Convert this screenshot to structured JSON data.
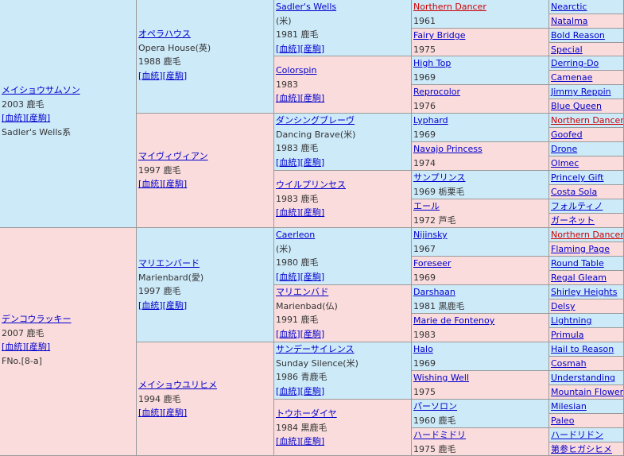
{
  "sire": {
    "name": "メイショウサムソン",
    "year_color": "2003 鹿毛",
    "links": [
      "[血統]",
      "[産駒]"
    ],
    "line": "Sadler's Wells系",
    "sire": {
      "name": "オペラハウス",
      "name_en": "Opera House(英)",
      "year_color": "1988 鹿毛",
      "links": [
        "[血統]",
        "[産駒]"
      ],
      "sire": {
        "name": "Sadler's Wells",
        "country": "(米)",
        "year_color": "1981 鹿毛",
        "links": [
          "[血統]",
          "[産駒]"
        ],
        "sire": {
          "name": "Northern Dancer",
          "year": "1961",
          "sire": "Nearctic",
          "dam": "Natalma"
        },
        "dam": {
          "name": "Fairy Bridge",
          "year": "1975",
          "sire": "Bold Reason",
          "dam": "Special"
        }
      },
      "dam": {
        "name": "Colorspin",
        "year_color": "1983",
        "links": [
          "[血統]",
          "[産駒]"
        ],
        "sire": {
          "name": "High Top",
          "year": "1969",
          "sire": "Derring-Do",
          "dam": "Camenae"
        },
        "dam": {
          "name": "Reprocolor",
          "year": "1976",
          "sire": "Jimmy Reppin",
          "dam": "Blue Queen"
        }
      }
    },
    "dam": {
      "name": "マイヴィヴィアン",
      "year_color": "1997 鹿毛",
      "links": [
        "[血統]",
        "[産駒]"
      ],
      "sire": {
        "name": "ダンシングブレーヴ",
        "name_en": "Dancing Brave(米)",
        "year_color": "1983 鹿毛",
        "links": [
          "[血統]",
          "[産駒]"
        ],
        "sire": {
          "name": "Lyphard",
          "year": "1969",
          "sire": "Northern Dancer",
          "dam": "Goofed"
        },
        "dam": {
          "name": "Navajo Princess",
          "year": "1974",
          "sire": "Drone",
          "dam": "Olmec"
        }
      },
      "dam": {
        "name": "ウイルプリンセス",
        "year_color": "1983 鹿毛",
        "links": [
          "[血統]",
          "[産駒]"
        ],
        "sire": {
          "name": "サンプリンス",
          "year": "1969 栃栗毛",
          "sire": "Princely Gift",
          "dam": "Costa Sola"
        },
        "dam": {
          "name": "エール",
          "year": "1972 芦毛",
          "sire": "フォルティノ",
          "dam": "ガーネット"
        }
      }
    }
  },
  "dam": {
    "name": "デンコウラッキー",
    "year_color": "2007 鹿毛",
    "links": [
      "[血統]",
      "[産駒]"
    ],
    "family": "FNo.[8-a]",
    "sire": {
      "name": "マリエンバード",
      "name_en": "Marienbard(愛)",
      "year_color": "1997 鹿毛",
      "links": [
        "[血統]",
        "[産駒]"
      ],
      "sire": {
        "name": "Caerleon",
        "country": "(米)",
        "year_color": "1980 鹿毛",
        "links": [
          "[血統]",
          "[産駒]"
        ],
        "sire": {
          "name": "Nijinsky",
          "year": "1967",
          "sire": "Northern Dancer",
          "dam": "Flaming Page"
        },
        "dam": {
          "name": "Foreseer",
          "year": "1969",
          "sire": "Round Table",
          "dam": "Regal Gleam"
        }
      },
      "dam": {
        "name": "マリエンバド",
        "name_en": "Marienbad(仏)",
        "year_color": "1991 鹿毛",
        "links": [
          "[血統]",
          "[産駒]"
        ],
        "sire": {
          "name": "Darshaan",
          "year": "1981 黒鹿毛",
          "sire": "Shirley Heights",
          "dam": "Delsy"
        },
        "dam": {
          "name": "Marie de Fontenoy",
          "year": "1983",
          "sire": "Lightning",
          "dam": "Primula"
        }
      }
    },
    "dam": {
      "name": "メイショウユリヒメ",
      "year_color": "1994 鹿毛",
      "links": [
        "[血統]",
        "[産駒]"
      ],
      "sire": {
        "name": "サンデーサイレンス",
        "name_en": "Sunday Silence(米)",
        "year_color": "1986 青鹿毛",
        "links": [
          "[血統]",
          "[産駒]"
        ],
        "sire": {
          "name": "Halo",
          "year": "1969",
          "sire": "Hail to Reason",
          "dam": "Cosmah"
        },
        "dam": {
          "name": "Wishing Well",
          "year": "1975",
          "sire": "Understanding",
          "dam": "Mountain Flower"
        }
      },
      "dam": {
        "name": "トウホーダイヤ",
        "year_color": "1984 黒鹿毛",
        "links": [
          "[血統]",
          "[産駒]"
        ],
        "sire": {
          "name": "パーソロン",
          "year": "1960 鹿毛",
          "sire": "Milesian",
          "dam": "Paleo"
        },
        "dam": {
          "name": "ハードミドリ",
          "year": "1975 鹿毛",
          "sire": "ハードリドン",
          "dam": "第参ヒガシヒメ"
        }
      }
    }
  },
  "highlight_color": "#cc0000",
  "highlighted_names": [
    "Northern Dancer"
  ]
}
